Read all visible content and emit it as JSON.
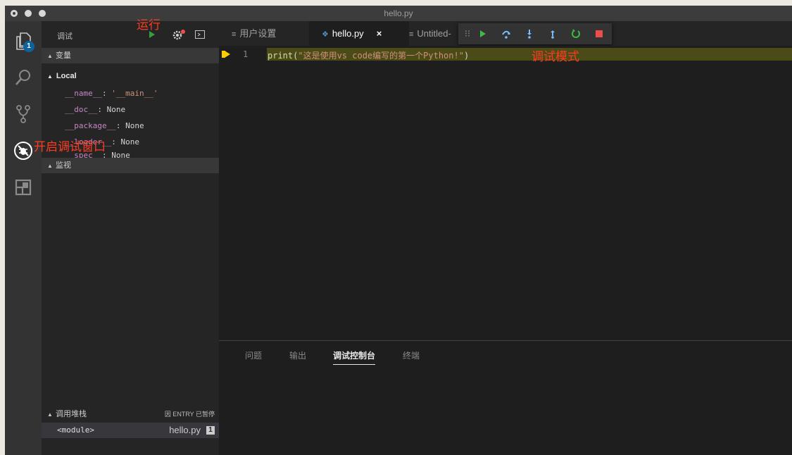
{
  "window": {
    "title": "hello.py"
  },
  "activity_bar": {
    "items": [
      "explorer-icon",
      "search-icon",
      "source-control-icon",
      "debug-icon",
      "extensions-icon"
    ],
    "explorer_badge": "1"
  },
  "sidebar": {
    "title": "调试",
    "variables_header": "变量",
    "scope": "Local",
    "variables": [
      {
        "name": "__name__",
        "sep": ": ",
        "value": "'__main__'"
      },
      {
        "name": "__doc__",
        "sep": ": ",
        "value": "None"
      },
      {
        "name": "__package__",
        "sep": ": ",
        "value": "None"
      },
      {
        "name": "__loader__",
        "sep": ": ",
        "value": "None"
      },
      {
        "name": "__spec__",
        "sep": ": ",
        "value": "None"
      }
    ],
    "watch_header": "监视",
    "callstack_header": "调用堆栈",
    "callstack_status": "因 ENTRY 已暂停",
    "callstack_frame": "<module>",
    "callstack_file": "hello.py",
    "callstack_line": "1"
  },
  "tabs": [
    {
      "label": "用户设置",
      "icon": "≡"
    },
    {
      "label": "hello.py",
      "icon": "❖",
      "close": "×"
    },
    {
      "label": "Untitled-",
      "icon": "≡"
    }
  ],
  "editor": {
    "line_number": "1",
    "code_fn": "print",
    "code_open": "(",
    "code_str": "\"这是使用vs code编写的第一个Python!\"",
    "code_close": ")"
  },
  "panel": {
    "tabs": [
      "问题",
      "输出",
      "调试控制台",
      "终端"
    ],
    "active_tab": "调试控制台"
  },
  "annotations": {
    "run": "运行",
    "debug_mode": "调试模式",
    "open_debug": "开启调试窗口"
  },
  "colors": {
    "accent": "#0e639c",
    "annotation": "#ff3b1f",
    "breakpoint": "#ffcc00",
    "continue": "#3dbb45",
    "stop": "#f14c4c"
  }
}
